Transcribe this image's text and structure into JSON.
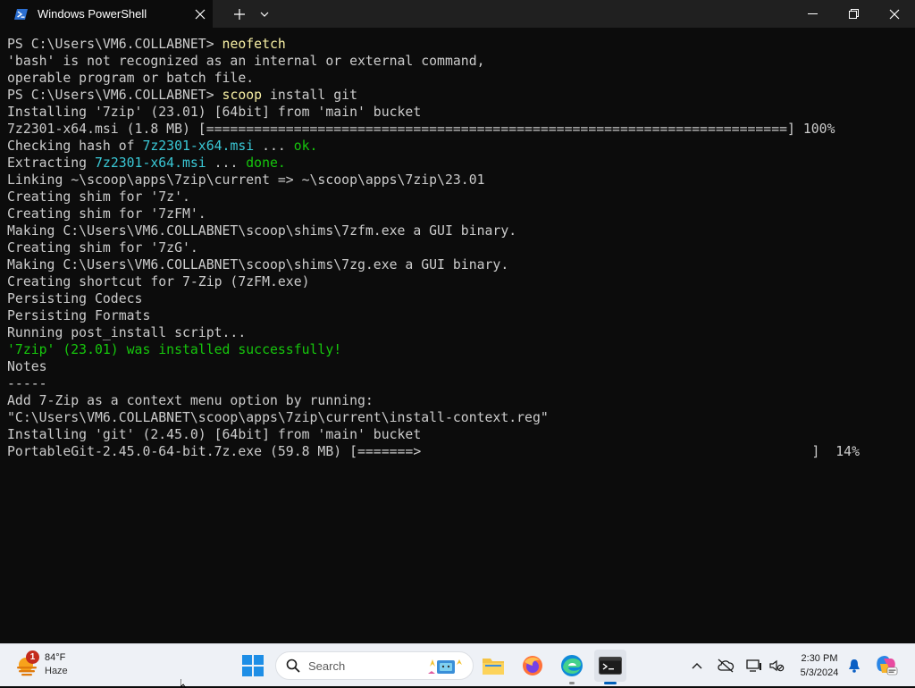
{
  "window": {
    "tab_title": "Windows PowerShell"
  },
  "terminal": {
    "lines": [
      [
        {
          "t": "PS C:\\Users\\VM6.COLLABNET> "
        },
        {
          "t": "neofetch",
          "c": "yellow"
        }
      ],
      [
        {
          "t": "'bash' is not recognized as an internal or external command,"
        }
      ],
      [
        {
          "t": "operable program or batch file."
        }
      ],
      [
        {
          "t": "PS C:\\Users\\VM6.COLLABNET> "
        },
        {
          "t": "scoop",
          "c": "yellow"
        },
        {
          "t": " install git"
        }
      ],
      [
        {
          "t": "Installing '7zip' (23.01) [64bit] from 'main' bucket"
        }
      ],
      [
        {
          "t": "7z2301-x64.msi (1.8 MB) [=========================================================================]"
        },
        {
          "t": " 100%",
          "c": "plain"
        }
      ],
      [
        {
          "t": "Checking hash of "
        },
        {
          "t": "7z2301-x64.msi",
          "c": "cyan"
        },
        {
          "t": " ... "
        },
        {
          "t": "ok.",
          "c": "green"
        }
      ],
      [
        {
          "t": "Extracting "
        },
        {
          "t": "7z2301-x64.msi",
          "c": "cyan"
        },
        {
          "t": " ... "
        },
        {
          "t": "done.",
          "c": "green"
        }
      ],
      [
        {
          "t": "Linking ~\\scoop\\apps\\7zip\\current => ~\\scoop\\apps\\7zip\\23.01"
        }
      ],
      [
        {
          "t": "Creating shim for '7z'."
        }
      ],
      [
        {
          "t": "Creating shim for '7zFM'."
        }
      ],
      [
        {
          "t": "Making C:\\Users\\VM6.COLLABNET\\scoop\\shims\\7zfm.exe a GUI binary."
        }
      ],
      [
        {
          "t": "Creating shim for '7zG'."
        }
      ],
      [
        {
          "t": "Making C:\\Users\\VM6.COLLABNET\\scoop\\shims\\7zg.exe a GUI binary."
        }
      ],
      [
        {
          "t": "Creating shortcut for 7-Zip (7zFM.exe)"
        }
      ],
      [
        {
          "t": "Persisting Codecs"
        }
      ],
      [
        {
          "t": "Persisting Formats"
        }
      ],
      [
        {
          "t": "Running post_install script..."
        }
      ],
      [
        {
          "t": "'7zip' (23.01) was installed successfully!",
          "c": "green"
        }
      ],
      [
        {
          "t": "Notes"
        }
      ],
      [
        {
          "t": "-----"
        }
      ],
      [
        {
          "t": "Add 7-Zip as a context menu option by running:"
        }
      ],
      [
        {
          "t": "\"C:\\Users\\VM6.COLLABNET\\scoop\\apps\\7zip\\current\\install-context.reg\""
        }
      ],
      [
        {
          "t": "Installing 'git' (2.45.0) [64bit] from 'main' bucket"
        }
      ],
      [
        {
          "t": "PortableGit-2.45.0-64-bit.7z.exe (59.8 MB) [=======>"
        },
        {
          "t": "]  14%",
          "c": "right"
        }
      ]
    ]
  },
  "taskbar": {
    "weather": {
      "badge": "1",
      "temp": "84°F",
      "condition": "Haze"
    },
    "search_placeholder": "Search",
    "clock": {
      "time": "2:30 PM",
      "date": "5/3/2024"
    }
  },
  "colors": {
    "terminal_bg": "#0c0c0c",
    "command": "#f9f1a5",
    "filename": "#3ac8d6",
    "success": "#16c60c",
    "accent": "#005fb8"
  }
}
